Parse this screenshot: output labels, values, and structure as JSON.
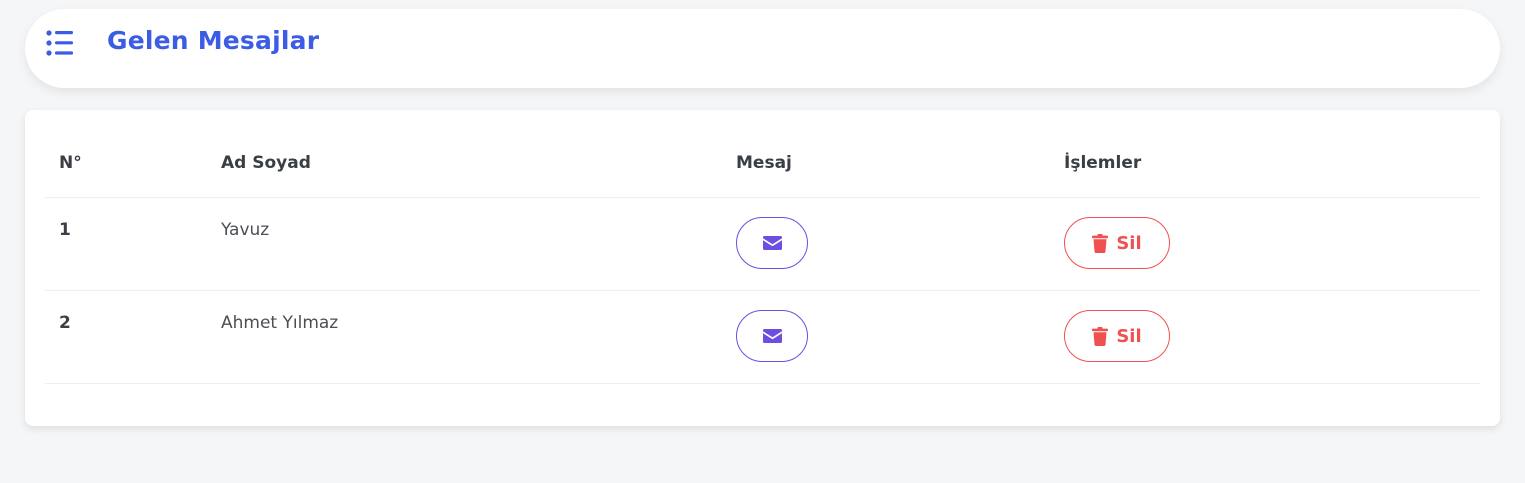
{
  "header": {
    "title": "Gelen Mesajlar"
  },
  "table": {
    "columns": [
      "N°",
      "Ad Soyad",
      "Mesaj",
      "İşlemler"
    ],
    "rows": [
      {
        "no": "1",
        "name": "Yavuz",
        "delete_label": "Sil"
      },
      {
        "no": "2",
        "name": "Ahmet Yılmaz",
        "delete_label": "Sil"
      }
    ]
  },
  "colors": {
    "title": "#3d5ce6",
    "mail_button": "#6d4ee0",
    "delete_button": "#f05050",
    "background": "#f5f6f8"
  },
  "icons": {
    "menu": "list-icon",
    "message": "envelope-icon",
    "delete": "trash-icon"
  }
}
